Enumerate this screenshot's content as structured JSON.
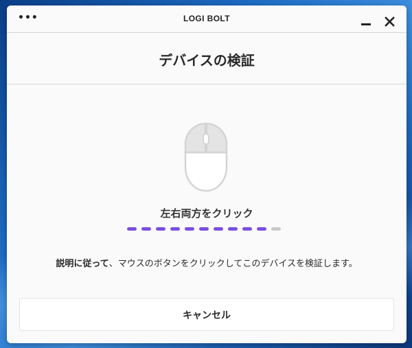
{
  "app": {
    "title": "LOGI BOLT",
    "menu_label": "•••"
  },
  "page": {
    "title": "デバイスの検証"
  },
  "verification": {
    "instruction": "左右両方をクリック",
    "progress": {
      "completed_steps": 10,
      "total_steps": 11
    },
    "description_strong": "説明に従って",
    "description_rest": "、マウスのボタンをクリックしてこのデバイスを検証します。"
  },
  "actions": {
    "cancel_label": "キャンセル"
  },
  "icons": {
    "menu": "more-dots-icon",
    "minimize": "minimize-icon",
    "close": "close-icon",
    "illustration": "mouse-icon"
  },
  "colors": {
    "progress_done": "#7b4fe0",
    "progress_pending": "#c8c8c8",
    "mouse_buttons_fill": "#e4e4e4",
    "mouse_outline": "#d4d4d4"
  }
}
